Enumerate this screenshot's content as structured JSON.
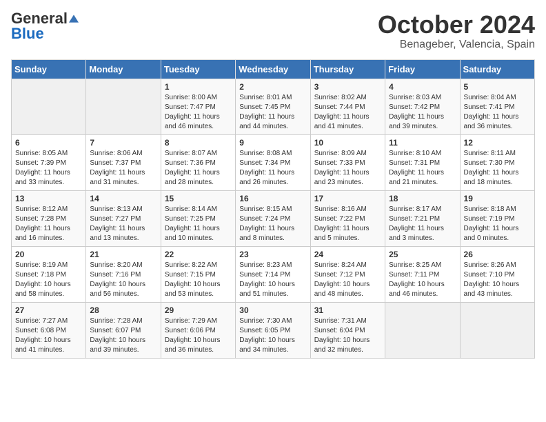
{
  "header": {
    "logo_general": "General",
    "logo_blue": "Blue",
    "month_title": "October 2024",
    "location": "Benageber, Valencia, Spain"
  },
  "days_of_week": [
    "Sunday",
    "Monday",
    "Tuesday",
    "Wednesday",
    "Thursday",
    "Friday",
    "Saturday"
  ],
  "weeks": [
    [
      {
        "day": "",
        "info": ""
      },
      {
        "day": "",
        "info": ""
      },
      {
        "day": "1",
        "info": "Sunrise: 8:00 AM\nSunset: 7:47 PM\nDaylight: 11 hours and 46 minutes."
      },
      {
        "day": "2",
        "info": "Sunrise: 8:01 AM\nSunset: 7:45 PM\nDaylight: 11 hours and 44 minutes."
      },
      {
        "day": "3",
        "info": "Sunrise: 8:02 AM\nSunset: 7:44 PM\nDaylight: 11 hours and 41 minutes."
      },
      {
        "day": "4",
        "info": "Sunrise: 8:03 AM\nSunset: 7:42 PM\nDaylight: 11 hours and 39 minutes."
      },
      {
        "day": "5",
        "info": "Sunrise: 8:04 AM\nSunset: 7:41 PM\nDaylight: 11 hours and 36 minutes."
      }
    ],
    [
      {
        "day": "6",
        "info": "Sunrise: 8:05 AM\nSunset: 7:39 PM\nDaylight: 11 hours and 33 minutes."
      },
      {
        "day": "7",
        "info": "Sunrise: 8:06 AM\nSunset: 7:37 PM\nDaylight: 11 hours and 31 minutes."
      },
      {
        "day": "8",
        "info": "Sunrise: 8:07 AM\nSunset: 7:36 PM\nDaylight: 11 hours and 28 minutes."
      },
      {
        "day": "9",
        "info": "Sunrise: 8:08 AM\nSunset: 7:34 PM\nDaylight: 11 hours and 26 minutes."
      },
      {
        "day": "10",
        "info": "Sunrise: 8:09 AM\nSunset: 7:33 PM\nDaylight: 11 hours and 23 minutes."
      },
      {
        "day": "11",
        "info": "Sunrise: 8:10 AM\nSunset: 7:31 PM\nDaylight: 11 hours and 21 minutes."
      },
      {
        "day": "12",
        "info": "Sunrise: 8:11 AM\nSunset: 7:30 PM\nDaylight: 11 hours and 18 minutes."
      }
    ],
    [
      {
        "day": "13",
        "info": "Sunrise: 8:12 AM\nSunset: 7:28 PM\nDaylight: 11 hours and 16 minutes."
      },
      {
        "day": "14",
        "info": "Sunrise: 8:13 AM\nSunset: 7:27 PM\nDaylight: 11 hours and 13 minutes."
      },
      {
        "day": "15",
        "info": "Sunrise: 8:14 AM\nSunset: 7:25 PM\nDaylight: 11 hours and 10 minutes."
      },
      {
        "day": "16",
        "info": "Sunrise: 8:15 AM\nSunset: 7:24 PM\nDaylight: 11 hours and 8 minutes."
      },
      {
        "day": "17",
        "info": "Sunrise: 8:16 AM\nSunset: 7:22 PM\nDaylight: 11 hours and 5 minutes."
      },
      {
        "day": "18",
        "info": "Sunrise: 8:17 AM\nSunset: 7:21 PM\nDaylight: 11 hours and 3 minutes."
      },
      {
        "day": "19",
        "info": "Sunrise: 8:18 AM\nSunset: 7:19 PM\nDaylight: 11 hours and 0 minutes."
      }
    ],
    [
      {
        "day": "20",
        "info": "Sunrise: 8:19 AM\nSunset: 7:18 PM\nDaylight: 10 hours and 58 minutes."
      },
      {
        "day": "21",
        "info": "Sunrise: 8:20 AM\nSunset: 7:16 PM\nDaylight: 10 hours and 56 minutes."
      },
      {
        "day": "22",
        "info": "Sunrise: 8:22 AM\nSunset: 7:15 PM\nDaylight: 10 hours and 53 minutes."
      },
      {
        "day": "23",
        "info": "Sunrise: 8:23 AM\nSunset: 7:14 PM\nDaylight: 10 hours and 51 minutes."
      },
      {
        "day": "24",
        "info": "Sunrise: 8:24 AM\nSunset: 7:12 PM\nDaylight: 10 hours and 48 minutes."
      },
      {
        "day": "25",
        "info": "Sunrise: 8:25 AM\nSunset: 7:11 PM\nDaylight: 10 hours and 46 minutes."
      },
      {
        "day": "26",
        "info": "Sunrise: 8:26 AM\nSunset: 7:10 PM\nDaylight: 10 hours and 43 minutes."
      }
    ],
    [
      {
        "day": "27",
        "info": "Sunrise: 7:27 AM\nSunset: 6:08 PM\nDaylight: 10 hours and 41 minutes."
      },
      {
        "day": "28",
        "info": "Sunrise: 7:28 AM\nSunset: 6:07 PM\nDaylight: 10 hours and 39 minutes."
      },
      {
        "day": "29",
        "info": "Sunrise: 7:29 AM\nSunset: 6:06 PM\nDaylight: 10 hours and 36 minutes."
      },
      {
        "day": "30",
        "info": "Sunrise: 7:30 AM\nSunset: 6:05 PM\nDaylight: 10 hours and 34 minutes."
      },
      {
        "day": "31",
        "info": "Sunrise: 7:31 AM\nSunset: 6:04 PM\nDaylight: 10 hours and 32 minutes."
      },
      {
        "day": "",
        "info": ""
      },
      {
        "day": "",
        "info": ""
      }
    ]
  ]
}
